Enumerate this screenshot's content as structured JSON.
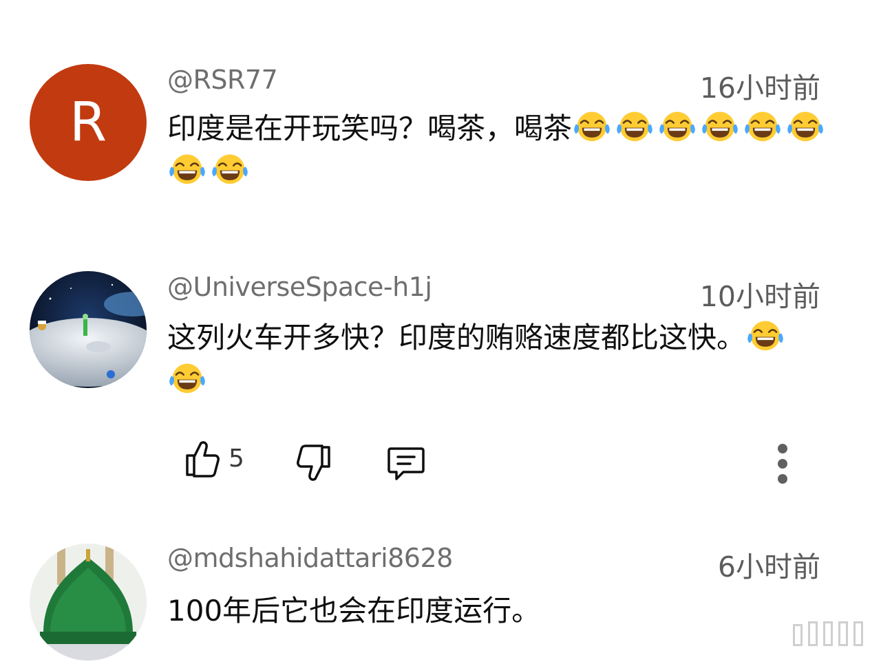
{
  "comments": [
    {
      "handle": "@RSR77",
      "time": "16小时前",
      "avatar_letter": "R",
      "text": "印度是在开玩笑吗？喝茶，喝茶",
      "emoji_count": 8,
      "emoji_icon": "face-with-tears-of-joy-icon"
    },
    {
      "handle": "@UniverseSpace-h1j",
      "time": "10小时前",
      "avatar_icon": "moon-astronaut-avatar",
      "text": "这列火车开多快？印度的贿赂速度都比这快。",
      "emoji_count": 2,
      "emoji_icon": "face-with-tears-of-joy-icon",
      "actions": {
        "like_count": "5",
        "like_icon": "thumbs-up-icon",
        "dislike_icon": "thumbs-down-icon",
        "reply_icon": "reply-icon",
        "more_icon": "more-vert-icon"
      }
    },
    {
      "handle": "@mdshahidattari8628",
      "time": "6小时前",
      "avatar_icon": "green-dome-avatar",
      "text": "100年后它也会在印度运行。"
    }
  ],
  "colors": {
    "avatar_r": "#c23a0f",
    "handle": "#6e6e6e",
    "time": "#5c5c5c",
    "text": "#0f0f0f"
  }
}
